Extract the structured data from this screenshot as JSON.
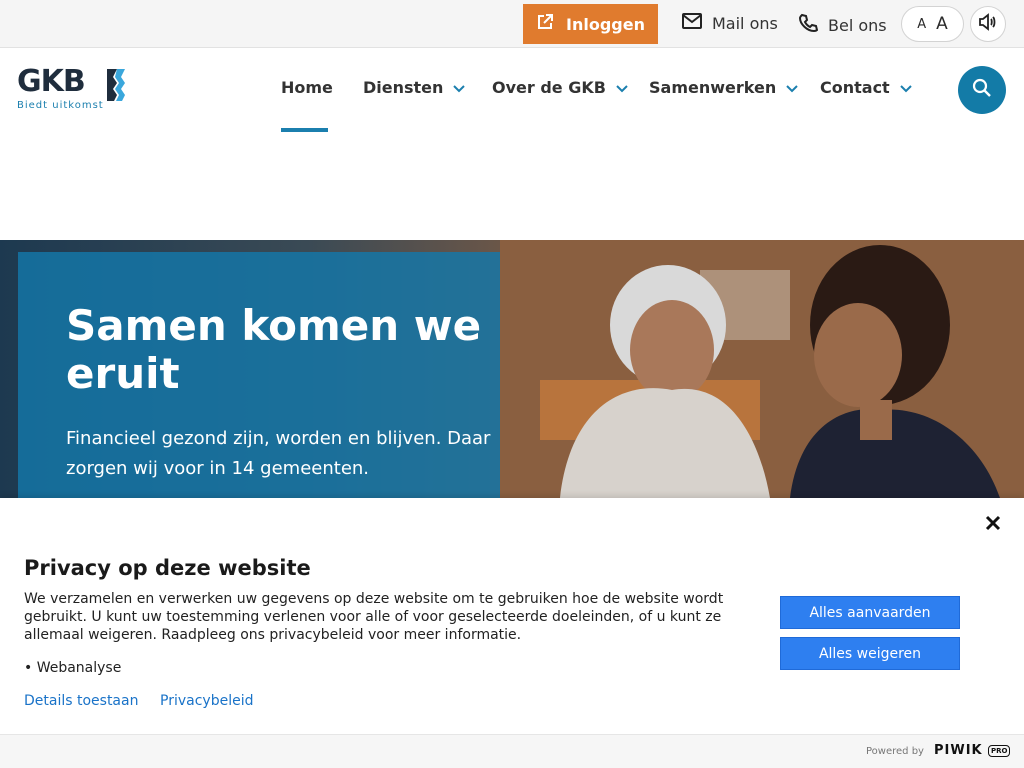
{
  "topbar": {
    "login_label": "Inloggen",
    "mail_label": "Mail ons",
    "phone_label": "Bel ons",
    "font_small": "A",
    "font_large": "A"
  },
  "logo": {
    "name": "GKB",
    "tagline": "Biedt uitkomst"
  },
  "nav": {
    "items": [
      {
        "label": "Home",
        "active": true
      },
      {
        "label": "Diensten",
        "has_dropdown": true
      },
      {
        "label": "Over de GKB",
        "has_dropdown": true
      },
      {
        "label": "Samenwerken",
        "has_dropdown": true
      },
      {
        "label": "Contact",
        "has_dropdown": true
      }
    ]
  },
  "hero": {
    "title": "Samen komen we eruit",
    "subtitle": "Financieel gezond zijn, worden en blijven. Daar zorgen wij voor in 14 gemeenten."
  },
  "privacy": {
    "title": "Privacy op deze website",
    "text": "We verzamelen en verwerken uw gegevens op deze website om te gebruiken hoe de website wordt gebruikt. U kunt uw toestemming verlenen voor alle of voor geselecteerde doeleinden, of u kunt ze allemaal weigeren. Raadpleeg ons privacybeleid voor meer informatie.",
    "bullet": "• Webanalyse",
    "details_link": "Details toestaan",
    "policy_link": "Privacybeleid",
    "accept_label": "Alles aanvaarden",
    "reject_label": "Alles weigeren"
  },
  "footer": {
    "powered_by": "Powered by",
    "brand": "PIWIK",
    "brand_suffix": "PRO"
  },
  "colors": {
    "accent_orange": "#e07b2e",
    "brand_blue": "#137ba7",
    "button_blue": "#2e7ff0",
    "link_blue": "#1a73c8"
  },
  "icons": {
    "login": "external-link-icon",
    "mail": "envelope-icon",
    "phone": "phone-icon",
    "speak": "speaker-icon",
    "search": "search-icon",
    "close": "close-icon",
    "dropdown": "chevron-down-icon"
  }
}
